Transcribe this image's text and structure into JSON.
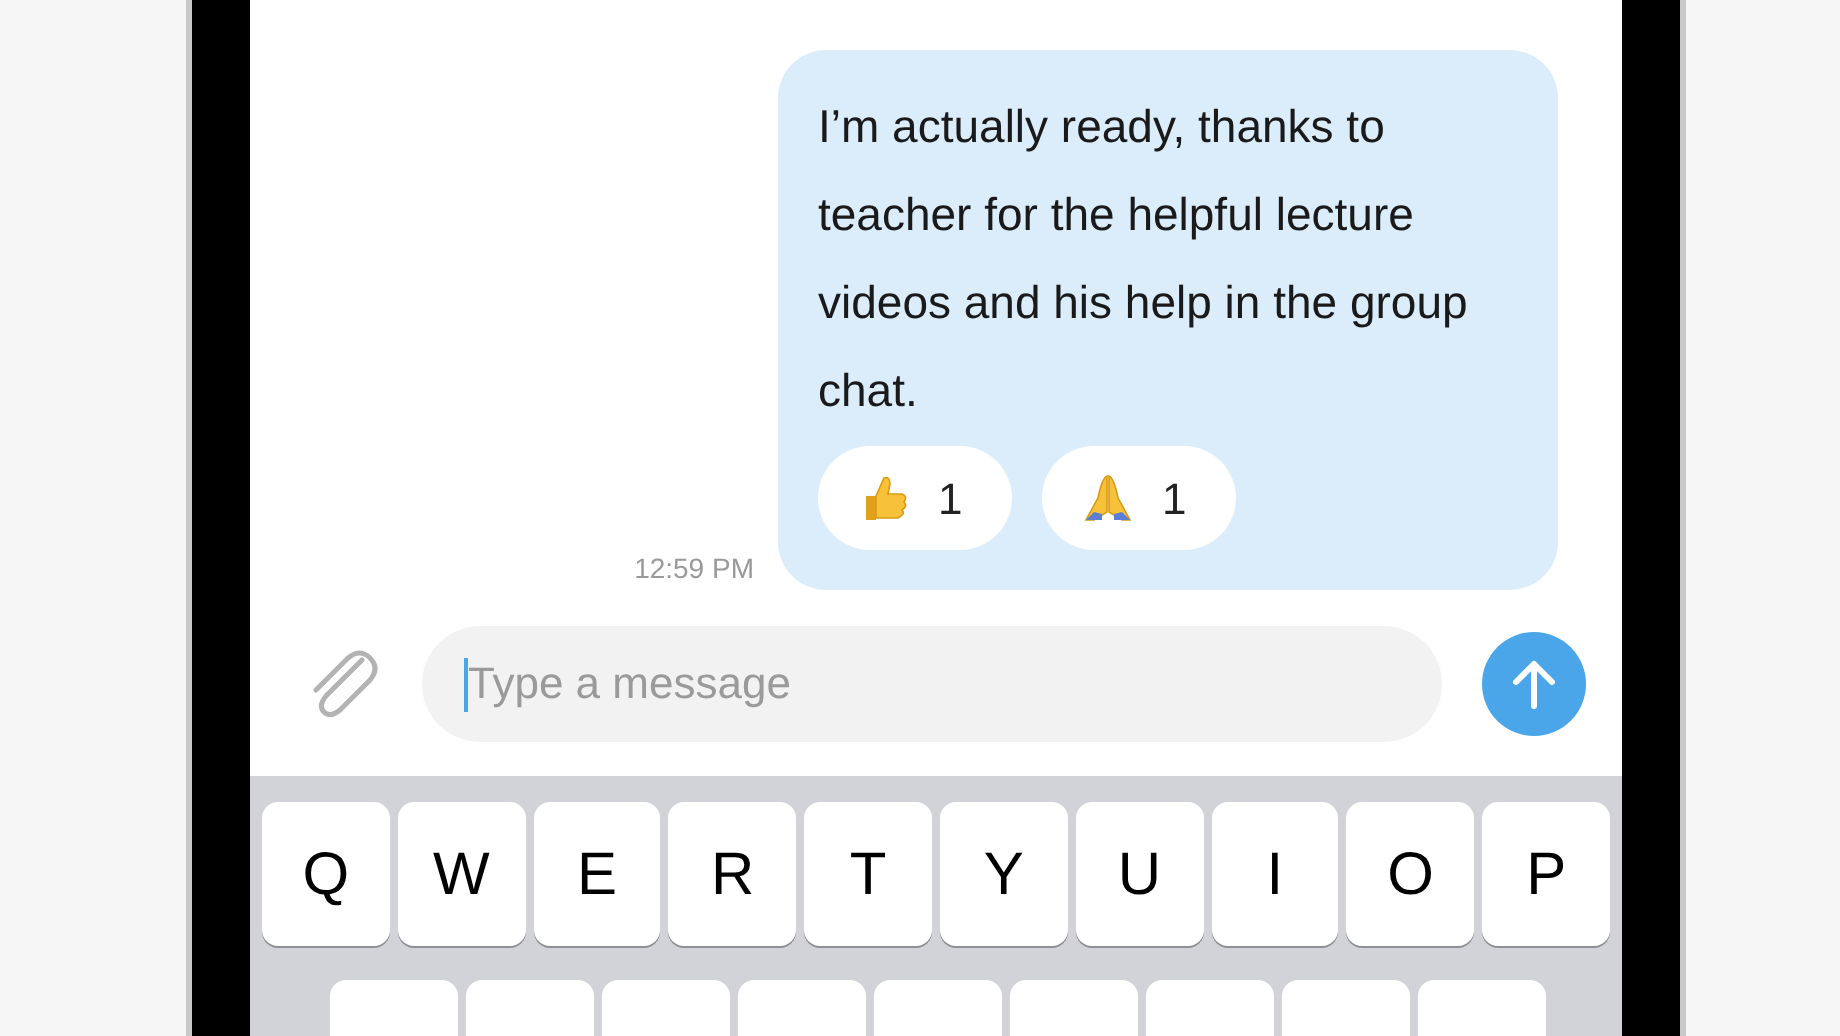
{
  "message": {
    "text": "I’m actually ready, thanks to teacher for the helpful lecture videos and his help in the group chat.",
    "time": "12:59 PM",
    "reactions": [
      {
        "kind": "thumbs-up",
        "count": "1"
      },
      {
        "kind": "praying-hands",
        "count": "1"
      }
    ]
  },
  "composer": {
    "placeholder": "Type a message"
  },
  "keyboard": {
    "top_row": [
      "Q",
      "W",
      "E",
      "R",
      "T",
      "Y",
      "U",
      "I",
      "O",
      "P"
    ]
  }
}
